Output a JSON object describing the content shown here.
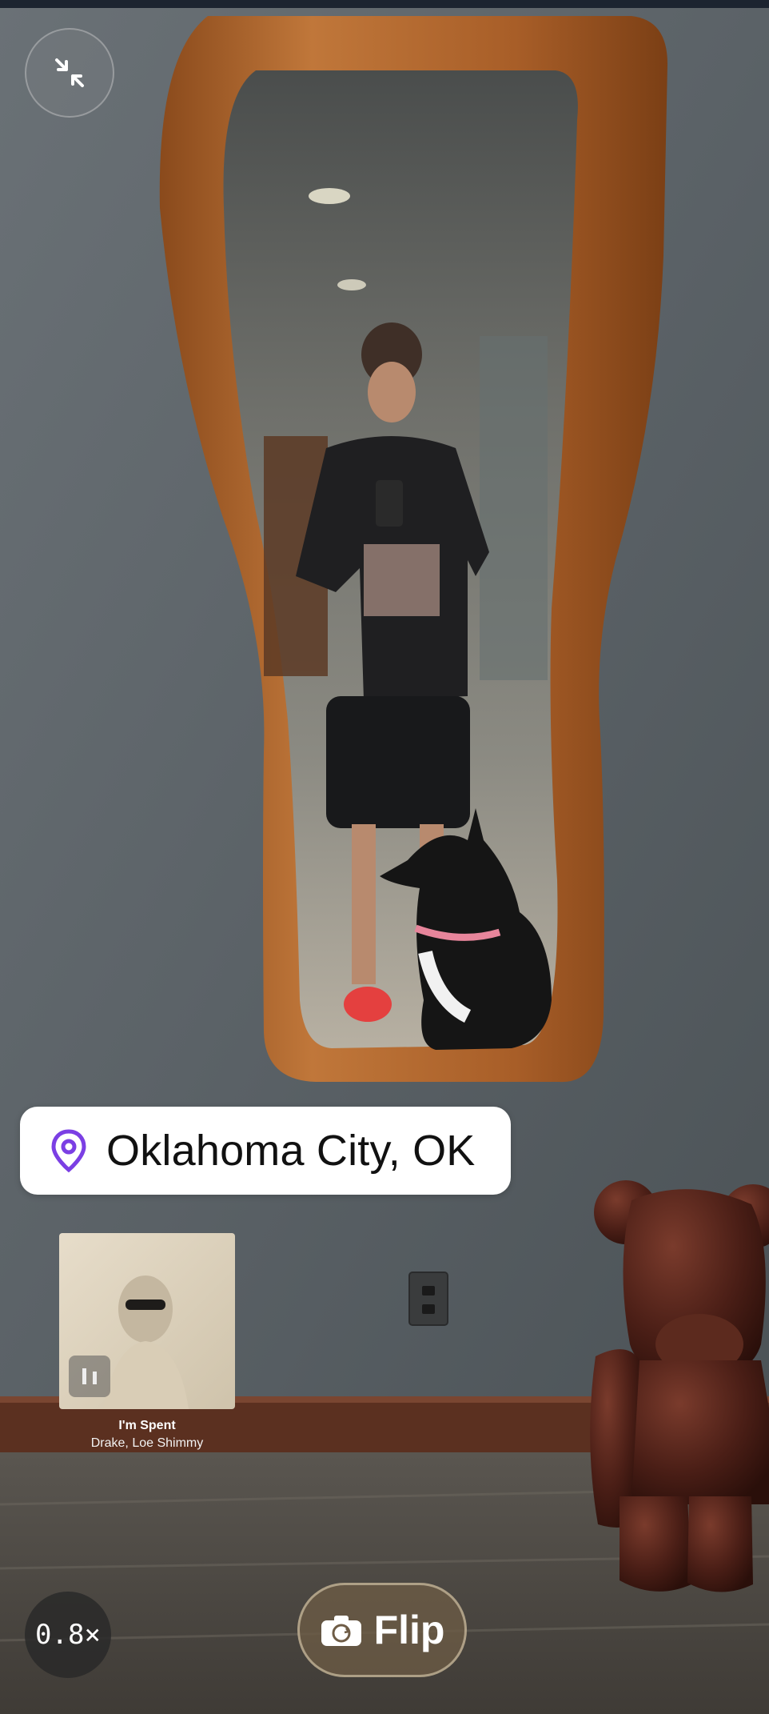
{
  "camera": {
    "collapse_icon": "collapse-arrows-icon",
    "location": {
      "icon": "map-pin-icon",
      "text": "Oklahoma City, OK",
      "pin_color": "#7b3fe4"
    },
    "music": {
      "title": "I'm Spent",
      "artist": "Drake, Loe Shimmy",
      "status_icon": "pause-icon"
    },
    "zoom": {
      "label": "0.8×"
    },
    "flip": {
      "label": "Flip",
      "icon": "camera-flip-icon"
    }
  }
}
